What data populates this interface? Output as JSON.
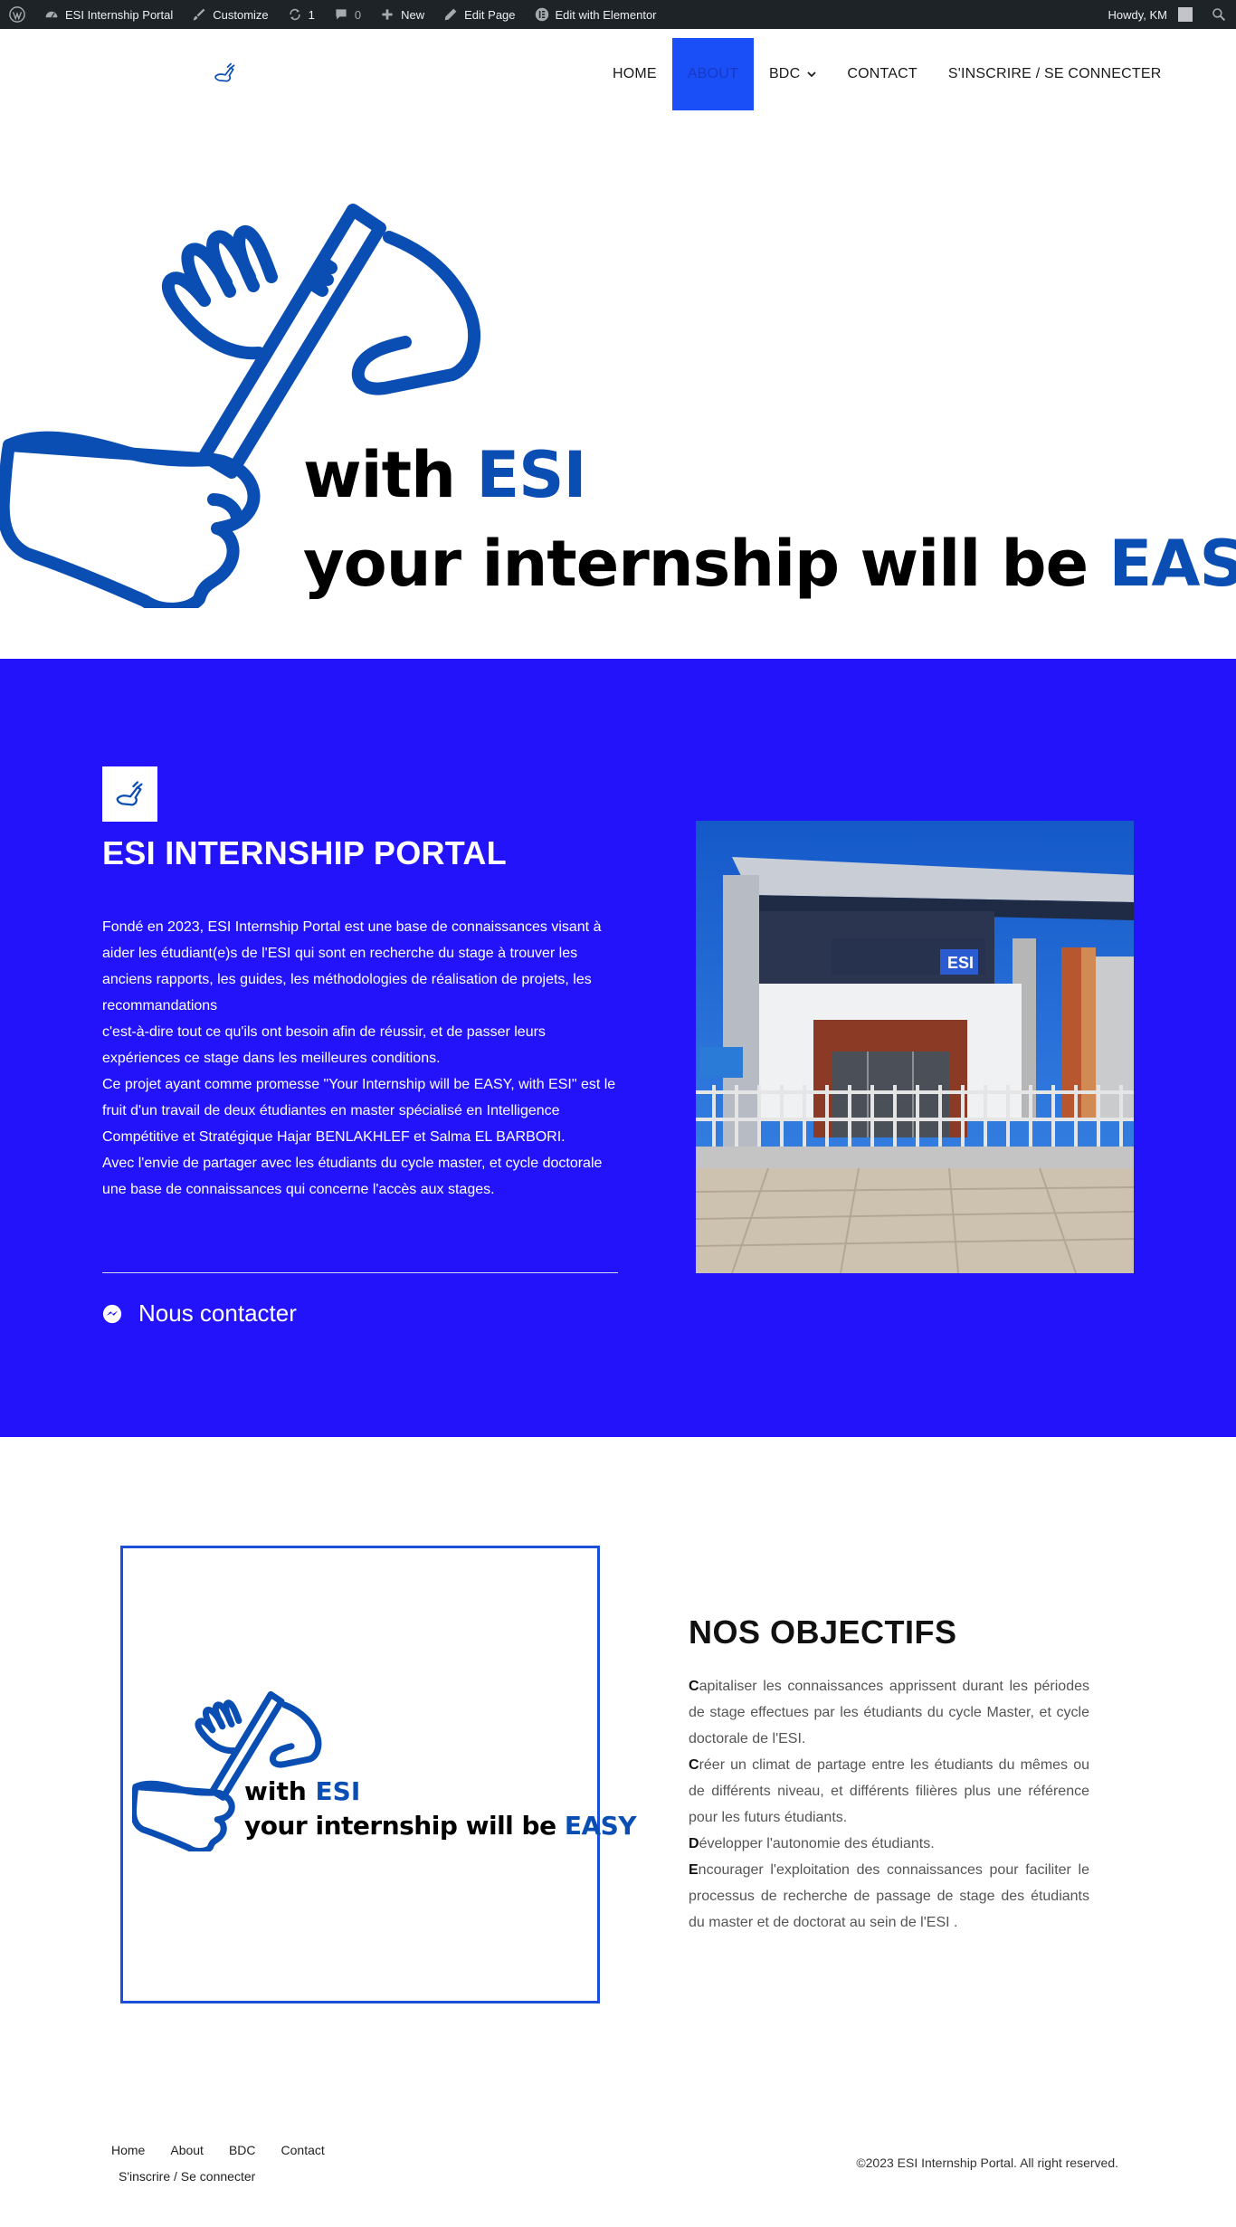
{
  "adminbar": {
    "site_name": "ESI Internship Portal",
    "customize": "Customize",
    "updates_count": "1",
    "comments_count": "0",
    "new_label": "New",
    "edit_page": "Edit Page",
    "edit_elementor": "Edit with Elementor",
    "howdy": "Howdy, KM"
  },
  "nav": {
    "items": [
      {
        "label": "HOME"
      },
      {
        "label": "ABOUT"
      },
      {
        "label": "BDC"
      },
      {
        "label": "CONTACT"
      },
      {
        "label": "S'INSCRIRE / SE CONNECTER"
      }
    ]
  },
  "hero": {
    "line1_prefix": "with ",
    "line1_accent": "ESI",
    "line2_prefix": "your internship will be ",
    "line2_accent": "EASY"
  },
  "about": {
    "title": "ESI INTERNSHIP PORTAL",
    "paragraphs": [
      "Fondé en 2023, ESI Internship Portal est une base de connaissances visant à aider les étudiant(e)s de l'ESI qui sont en recherche du stage à trouver les anciens rapports, les guides, les méthodologies de réalisation de projets, les recommandations",
      "c'est-à-dire tout ce qu'ils ont besoin afin de réussir, et de passer leurs expériences ce stage dans les meilleures conditions.",
      "Ce projet ayant comme promesse \"Your Internship will be EASY, with ESI\" est le fruit d'un travail de deux étudiantes en master spécialisé en Intelligence Compétitive et Stratégique Hajar BENLAKHLEF et Salma EL BARBORI.",
      "Avec l'envie de partager avec les étudiants du cycle master, et cycle doctorale une base de connaissances qui concerne l'accès aux stages."
    ],
    "contact_label": "Nous contacter",
    "building_sign": "ESI"
  },
  "objectives": {
    "title": "NOS OBJECTIFS",
    "items": [
      {
        "initial": "C",
        "rest": "apitaliser les connaissances apprissent durant les périodes de stage effectues par les étudiants du cycle Master, et cycle doctorale de l'ESI."
      },
      {
        "initial": "C",
        "rest": "réer un climat de partage entre les étudiants du mêmes ou de différents niveau, et différents filières plus une référence pour les futurs étudiants."
      },
      {
        "initial": "D",
        "rest": "évelopper l'autonomie des étudiants."
      },
      {
        "initial": "E",
        "rest": "ncourager l'exploitation des connaissances pour faciliter le processus de recherche de passage de stage des étudiants du master et de doctorat au sein de l'ESI ."
      }
    ],
    "image_line1_prefix": "with ",
    "image_line1_accent": "ESI",
    "image_line2_prefix": "your internship will be ",
    "image_line2_accent": "EASY"
  },
  "footer": {
    "links": [
      "Home",
      "About",
      "BDC",
      "Contact"
    ],
    "link_second_row": "S'inscrire / Se connecter",
    "copyright": "©2023 ESI Internship Portal. All right reserved."
  },
  "colors": {
    "brand_blue": "#0a4eb3",
    "section_blue": "#2213fb",
    "nav_active": "#1a4ff7",
    "adminbar": "#1d2327"
  }
}
